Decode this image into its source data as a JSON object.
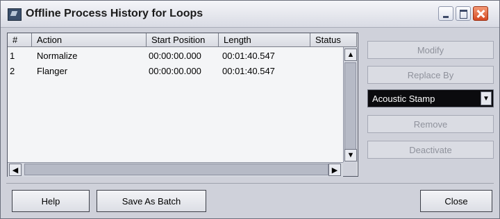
{
  "window": {
    "title": "Offline Process History for Loops"
  },
  "table": {
    "columns": [
      "#",
      "Action",
      "Start Position",
      "Length",
      "Status"
    ],
    "rows": [
      {
        "num": "1",
        "action": "Normalize",
        "start": "00:00:00.000",
        "length": "00:01:40.547",
        "status": ""
      },
      {
        "num": "2",
        "action": "Flanger",
        "start": "00:00:00.000",
        "length": "00:01:40.547",
        "status": ""
      }
    ]
  },
  "side": {
    "modify": "Modify",
    "replace_by": "Replace By",
    "combo_value": "Acoustic Stamp",
    "remove": "Remove",
    "deactivate": "Deactivate"
  },
  "bottom": {
    "help": "Help",
    "save_batch": "Save As Batch",
    "close": "Close"
  },
  "icons": {
    "app": "effect-window-icon",
    "minimize": "minimize-icon",
    "maximize": "maximize-icon",
    "close": "close-icon",
    "scroll_up": "arrow-up-icon",
    "scroll_down": "arrow-down-icon",
    "scroll_left": "arrow-left-icon",
    "scroll_right": "arrow-right-icon",
    "dropdown": "chevron-down-icon"
  },
  "colors": {
    "close_button": "#d54a23",
    "combo_bg": "#0b0b0e",
    "disabled_text": "#8f929c"
  }
}
